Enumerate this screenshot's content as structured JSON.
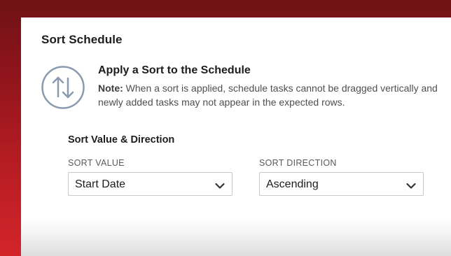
{
  "panel": {
    "title": "Sort Schedule"
  },
  "notice": {
    "icon": "sort-arrows-icon",
    "title": "Apply a Sort to the Schedule",
    "note_label": "Note:",
    "note_text": " When a sort is applied, schedule tasks cannot be dragged vertically and newly added tasks may not appear in the expected rows."
  },
  "sort_section": {
    "title": "Sort Value & Direction",
    "sort_value": {
      "label": "SORT VALUE",
      "selected": "Start Date"
    },
    "sort_direction": {
      "label": "SORT DIRECTION",
      "selected": "Ascending"
    }
  },
  "colors": {
    "background_red": "#b41c22",
    "icon_gray": "#8a9bb0",
    "text_dark": "#1d1d1d",
    "border": "#c9c9c9"
  }
}
